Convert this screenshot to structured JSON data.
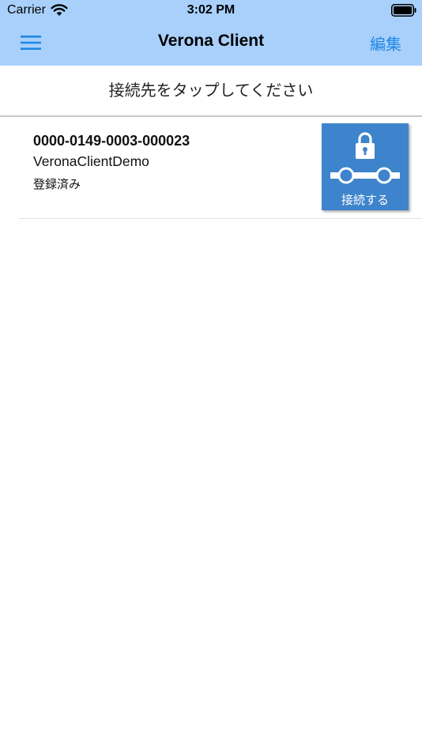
{
  "status_bar": {
    "carrier": "Carrier",
    "time": "3:02 PM"
  },
  "nav_bar": {
    "title": "Verona Client",
    "edit_label": "編集",
    "menu_icon": "hamburger-menu-icon",
    "background_color": "#a8d0fb",
    "accent_color": "#1e88e5"
  },
  "instruction": "接続先をタップしてください",
  "connections": [
    {
      "id": "0000-0149-0003-000023",
      "name": "VeronaClientDemo",
      "status": "登録済み",
      "connect_label": "接続する",
      "button_color": "#3e84cc"
    }
  ]
}
